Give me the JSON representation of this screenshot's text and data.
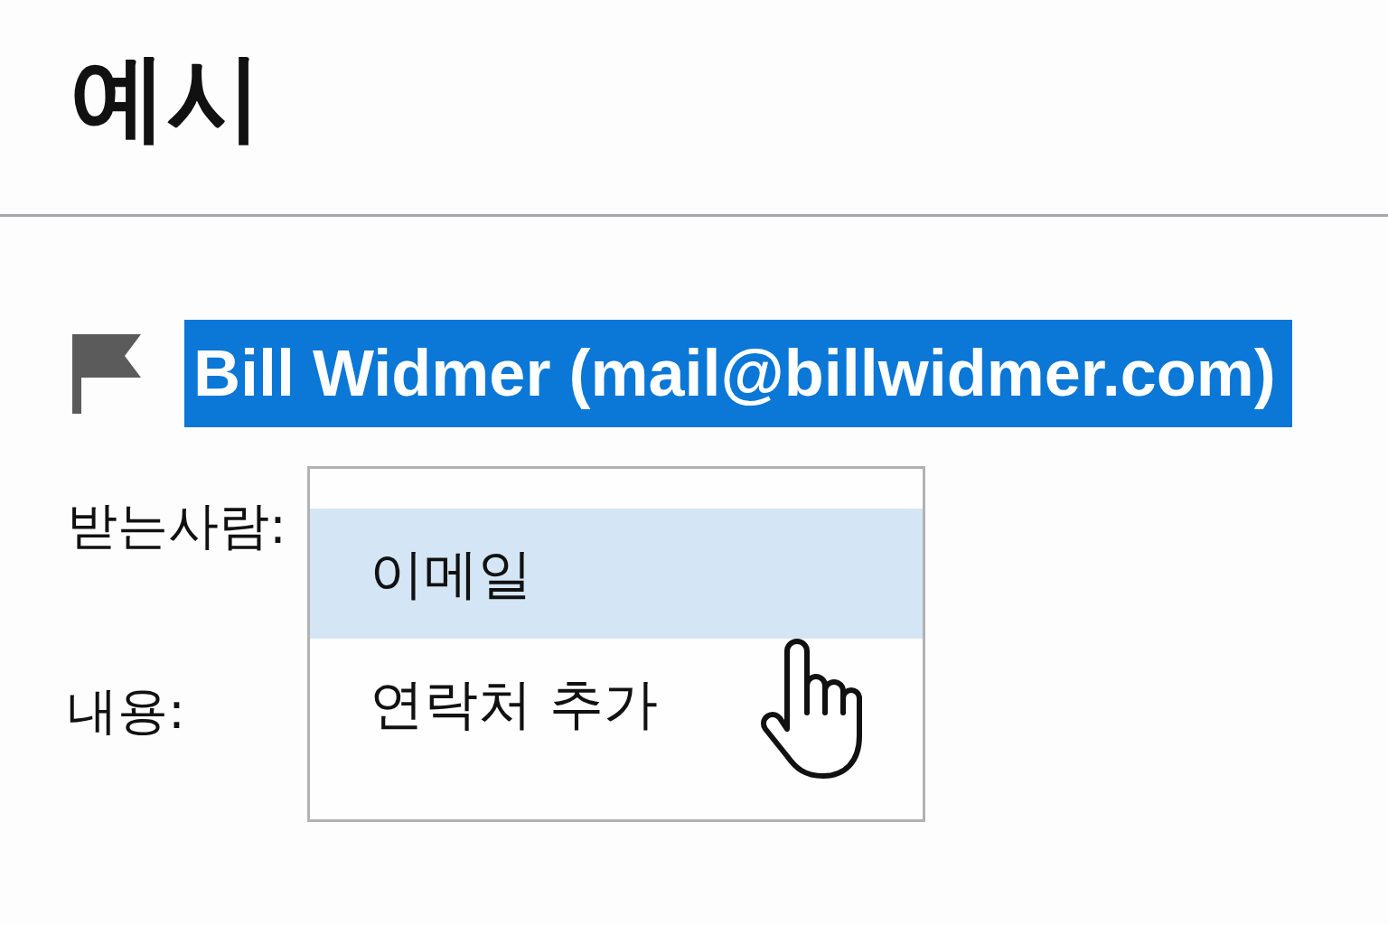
{
  "page": {
    "title": "예시"
  },
  "sender": {
    "name": "Bill Widmer (mail@billwidmer.com)",
    "selected": true
  },
  "fields": [
    {
      "label": "받는사람:"
    },
    {
      "label": "내용:"
    }
  ],
  "dropdown": {
    "items": [
      {
        "label": "이메일",
        "selected": true
      },
      {
        "label": "연락처 추가",
        "selected": false
      }
    ]
  }
}
